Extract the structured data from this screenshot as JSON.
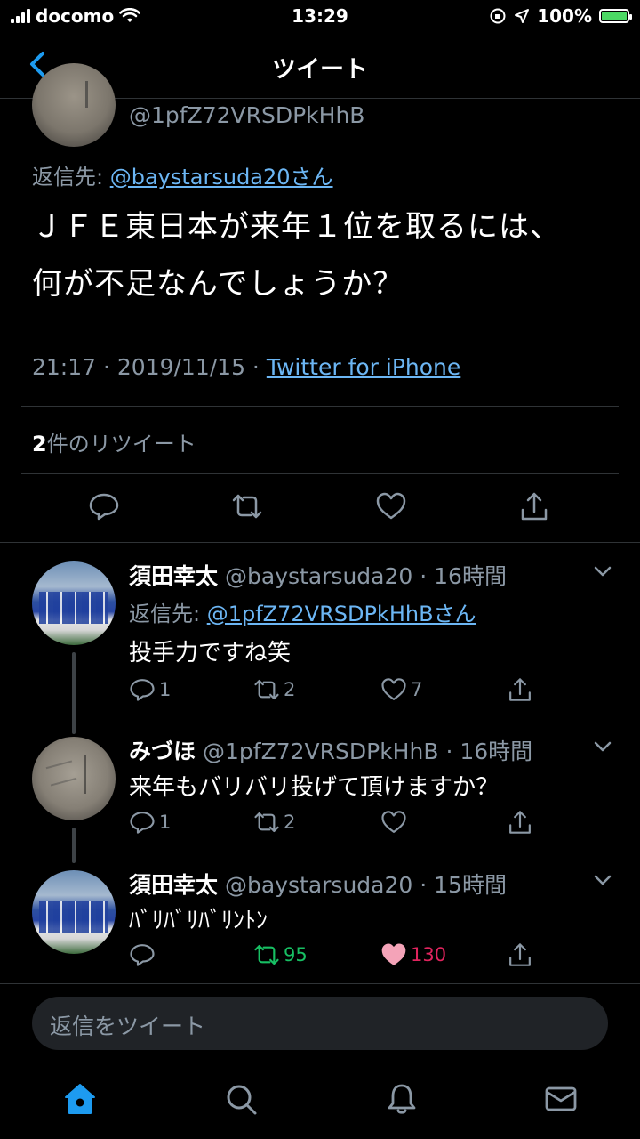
{
  "status_bar": {
    "carrier": "docomo",
    "time": "13:29",
    "battery": "100%"
  },
  "nav": {
    "title": "ツイート"
  },
  "main_tweet": {
    "handle": "@1pfZ72VRSDPkHhB",
    "reply_to_prefix": "返信先: ",
    "reply_to_user": "@baystarsuda20さん",
    "text_line1": "ＪＦＥ東日本が来年１位を取るには、",
    "text_line2": "何が不足なんでしょうか？",
    "time_date": "21:17 · 2019/11/15 · ",
    "source": "Twitter for iPhone",
    "retweet_count": "2",
    "retweet_label": "件のリツイート"
  },
  "replies": [
    {
      "name": "須田幸太",
      "handle": "@baystarsuda20",
      "time": "· 16時間",
      "reply_to_prefix": "返信先: ",
      "reply_to_user": "@1pfZ72VRSDPkHhBさん",
      "text": "投手力ですね笑",
      "reply_count": "1",
      "retweet_count": "2",
      "like_count": "7"
    },
    {
      "name": "みづほ",
      "handle": "@1pfZ72VRSDPkHhB",
      "time": "· 16時間",
      "text": "来年もバリバリ投げて頂けますか？",
      "reply_count": "1",
      "retweet_count": "2",
      "like_count": ""
    },
    {
      "name": "須田幸太",
      "handle": "@baystarsuda20",
      "time": "· 15時間",
      "text": "ﾊﾞﾘﾊﾞﾘﾊﾞﾘﾝﾄﾝ",
      "reply_count": "",
      "retweet_count": "95",
      "like_count": "130"
    }
  ],
  "composer": {
    "placeholder": "返信をツイート"
  },
  "colors": {
    "link": "#6cb6f4",
    "secondary_text": "#8b98a5",
    "retweet_active": "#17bf63",
    "like_active": "#e0245e",
    "accent": "#1d9bf0"
  }
}
